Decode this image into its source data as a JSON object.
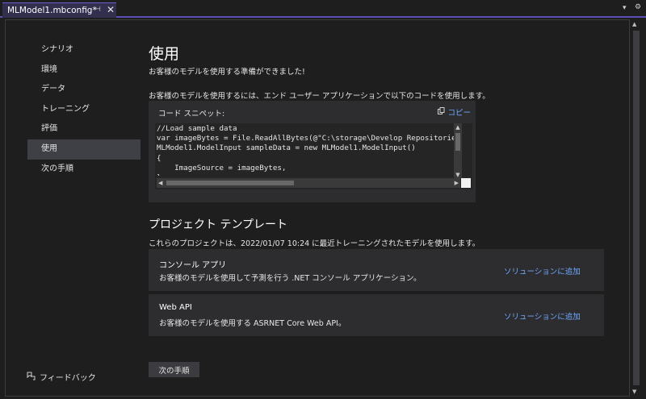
{
  "tab": {
    "title": "MLModel1.mbconfig*",
    "pin_glyph": "⊣",
    "close_glyph": "✕",
    "dropdown_glyph": "▾",
    "settings_glyph": "⚙"
  },
  "sidebar": {
    "items": [
      {
        "label": "シナリオ"
      },
      {
        "label": "環境"
      },
      {
        "label": "データ"
      },
      {
        "label": "トレーニング"
      },
      {
        "label": "評価"
      },
      {
        "label": "使用",
        "active": true
      },
      {
        "label": "次の手順"
      }
    ],
    "feedback_label": "フィードバック"
  },
  "main": {
    "title": "使用",
    "subtitle": "お客様のモデルを使用する準備ができました!",
    "instruction": "お客様のモデルを使用するには、エンド ユーザー アプリケーションで以下のコードを使用します。",
    "snippet": {
      "label": "コード スニペット:",
      "copy_label": "コピー",
      "code_lines": [
        "//Load sample data",
        "var imageBytes = File.ReadAllBytes(@\"C:\\storage\\Develop Repositories",
        "MLModel1.ModelInput sampleData = new MLModel1.ModelInput()",
        "{",
        "    ImageSource = imageBytes,",
        "};"
      ]
    },
    "templates": {
      "title": "プロジェクト テンプレート",
      "description": "これらのプロジェクトは、2022/01/07 10:24 に最近トレーニングされたモデルを使用します。",
      "cards": [
        {
          "title": "コンソール アプリ",
          "description": "お客様のモデルを使用して予測を行う .NET コンソール アプリケーション。",
          "link": "ソリューションに追加"
        },
        {
          "title": "Web API",
          "description": "お客様のモデルを使用する ASRNET Core Web API。",
          "link": "ソリューションに追加"
        }
      ]
    },
    "next_button": "次の手順"
  },
  "colors": {
    "accent": "#5a4fb5",
    "link": "#6fa9ff",
    "background": "#1e1e1e",
    "panel": "#2d2d30"
  }
}
